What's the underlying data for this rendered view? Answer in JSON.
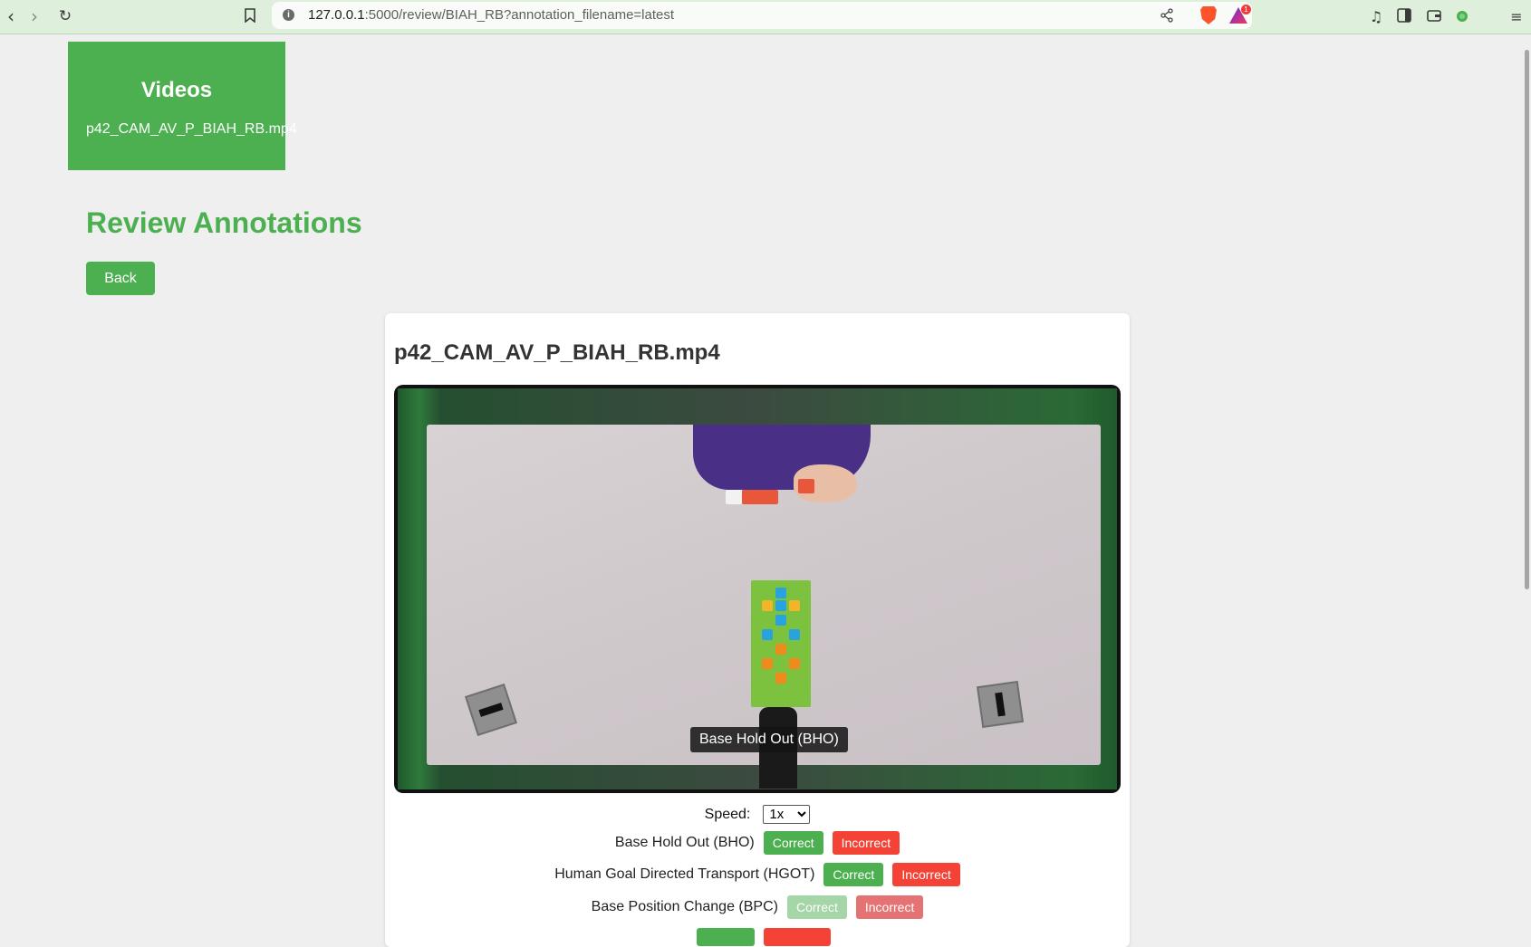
{
  "browser": {
    "url_host": "127.0.0.1",
    "url_rest": ":5000/review/BIAH_RB?annotation_filename=latest",
    "rewards_badge": "1"
  },
  "sidebar": {
    "title": "Videos",
    "items": [
      "p42_CAM_AV_P_BIAH_RB.mp4"
    ]
  },
  "page": {
    "title": "Review Annotations",
    "back_label": "Back"
  },
  "video": {
    "title": "p42_CAM_AV_P_BIAH_RB.mp4",
    "subtitle": "Base Hold Out (BHO)"
  },
  "speed": {
    "label": "Speed:",
    "selected": "1x"
  },
  "annotations": [
    {
      "label": "Base Hold Out (BHO)",
      "correct": "Correct",
      "incorrect": "Incorrect",
      "state": "active"
    },
    {
      "label": "Human Goal Directed Transport (HGOT)",
      "correct": "Correct",
      "incorrect": "Incorrect",
      "state": "active"
    },
    {
      "label": "Base Position Change (BPC)",
      "correct": "Correct",
      "incorrect": "Incorrect",
      "state": "faded"
    }
  ],
  "colors": {
    "accent_green": "#4caf50",
    "incorrect_red": "#f44336",
    "sleeve_purple": "#4a2f86"
  }
}
